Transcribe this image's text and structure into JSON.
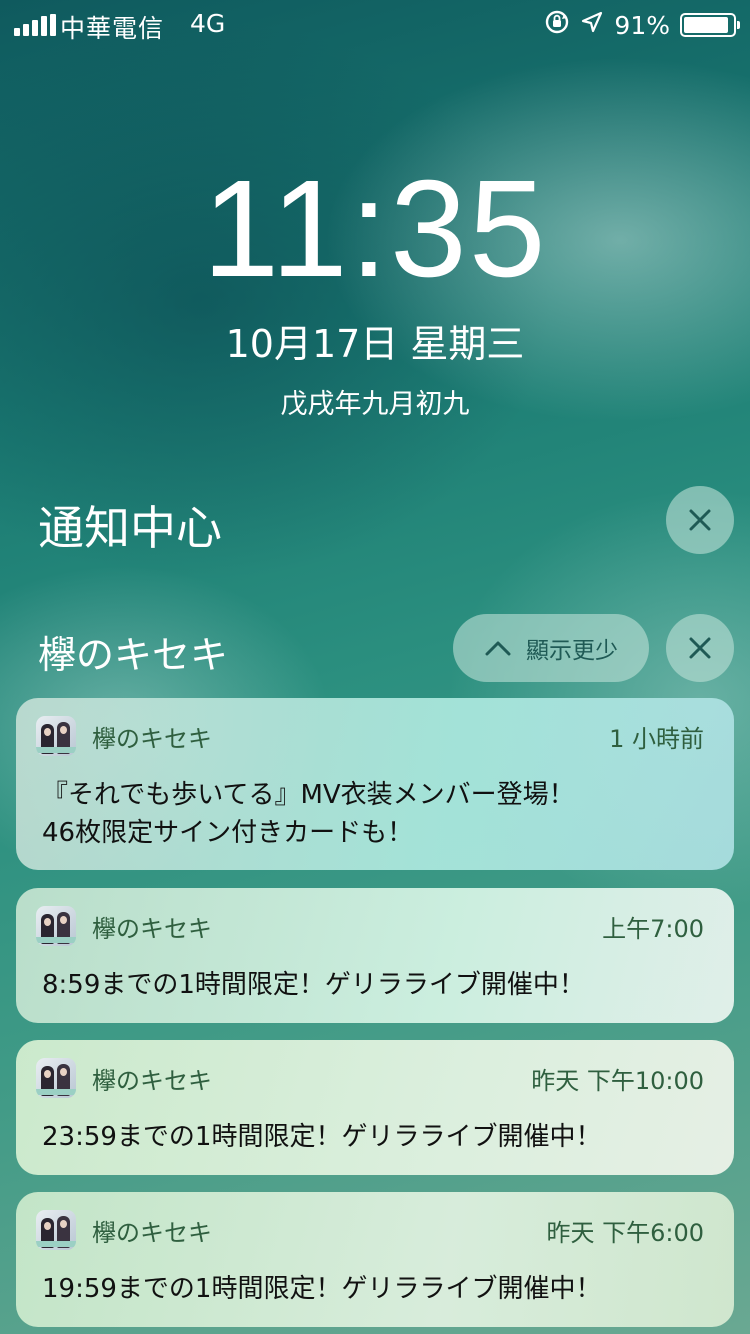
{
  "status_bar": {
    "carrier": "中華電信",
    "network": "4G",
    "battery_percent": "91%",
    "battery_level": 0.91,
    "icons": [
      "signal-icon",
      "rotation-lock-icon",
      "location-arrow-icon",
      "battery-icon"
    ]
  },
  "lock_screen": {
    "time": "11:35",
    "date": "10月17日 星期三",
    "lunar_date": "戊戌年九月初九"
  },
  "notification_center": {
    "title": "通知中心",
    "group_title": "欅のキセキ",
    "show_less_label": "顯示更少",
    "notifications": [
      {
        "app_name": "欅のキセキ",
        "time": "1 小時前",
        "line1": "『それでも歩いてる』MV衣装メンバー登場！",
        "line2": "46枚限定サイン付きカードも！"
      },
      {
        "app_name": "欅のキセキ",
        "time": "上午7:00",
        "line1": "8:59までの1時間限定！ゲリラライブ開催中！"
      },
      {
        "app_name": "欅のキセキ",
        "time": "昨天 下午10:00",
        "line1": "23:59までの1時間限定！ゲリラライブ開催中！"
      },
      {
        "app_name": "欅のキセキ",
        "time": "昨天 下午6:00",
        "line1": "19:59までの1時間限定！ゲリラライブ開催中！"
      }
    ]
  }
}
